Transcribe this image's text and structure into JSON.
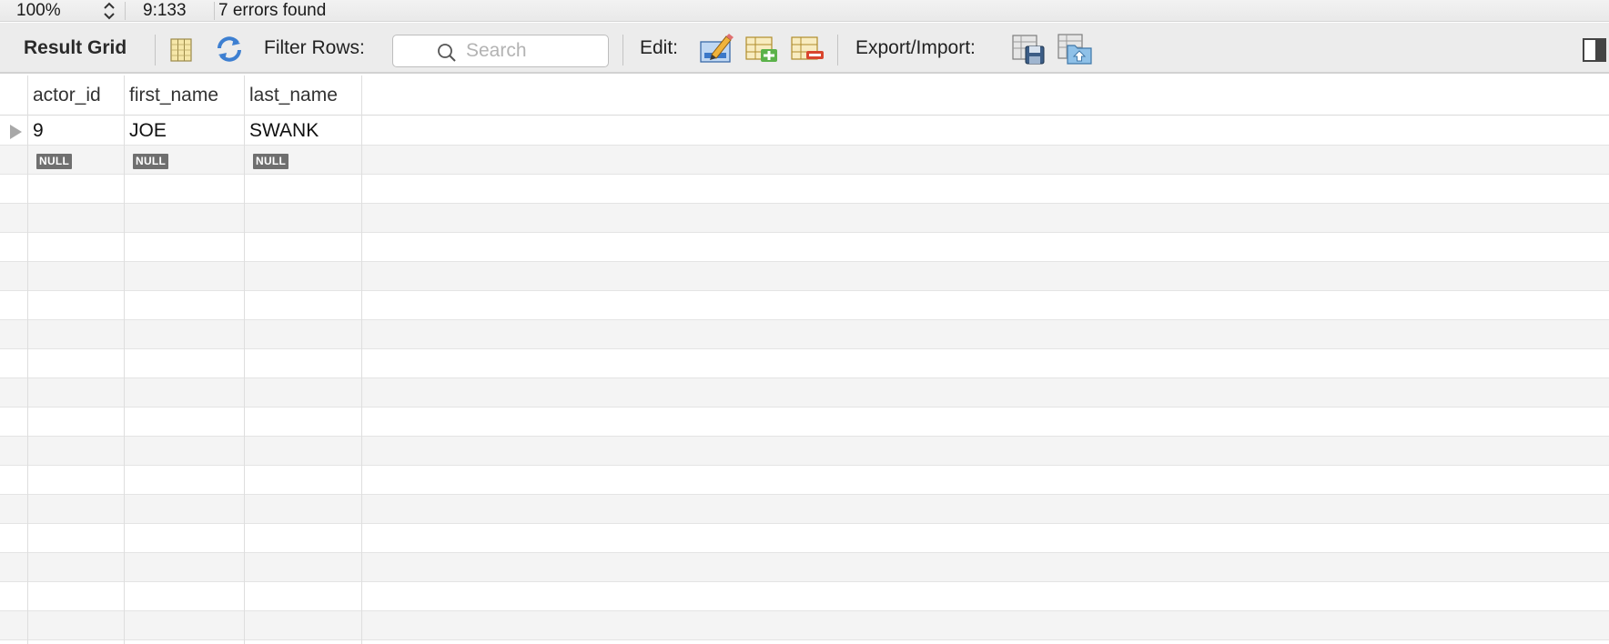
{
  "statusbar": {
    "zoom": "100%",
    "cursor_position": "9:133",
    "errors": "7 errors found"
  },
  "toolbar": {
    "result_grid_label": "Result Grid",
    "filter_rows_label": "Filter Rows:",
    "search_placeholder": "Search",
    "edit_label": "Edit:",
    "export_import_label": "Export/Import:",
    "icons": [
      "grid-columns-icon",
      "refresh-icon",
      "search-icon",
      "edit-pencil-icon",
      "add-row-icon",
      "delete-row-icon",
      "export-icon",
      "import-icon",
      "toggle-panel-icon"
    ]
  },
  "grid": {
    "columns": [
      "actor_id",
      "first_name",
      "last_name"
    ],
    "rows": [
      {
        "actor_id": "9",
        "first_name": "JOE",
        "last_name": "SWANK"
      }
    ],
    "new_row": {
      "actor_id": "NULL",
      "first_name": "NULL",
      "last_name": "NULL"
    }
  }
}
